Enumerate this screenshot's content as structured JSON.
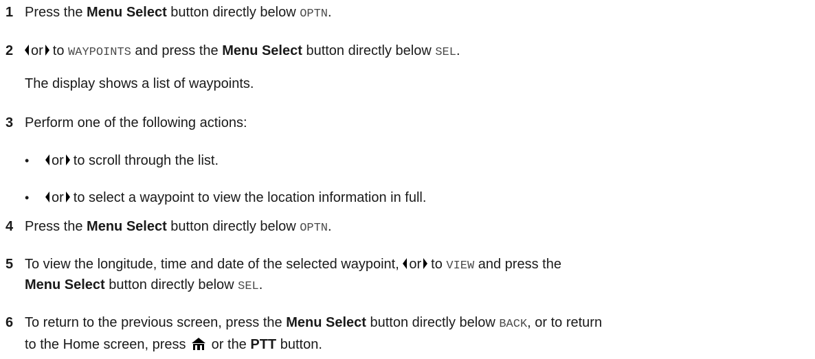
{
  "steps": [
    {
      "num": "1",
      "t1": "Press the ",
      "b1": "Menu Select",
      "t2": " button directly below ",
      "code": "OPTN",
      "end": "."
    },
    {
      "num": "2",
      "t1": "or",
      "t2": "to ",
      "code1": "WAYPOINTS",
      "t3": " and press the ",
      "b1": "Menu Select",
      "t4": " button directly below ",
      "code2": "SEL",
      "end": "."
    },
    {
      "note": "The display shows a list of waypoints."
    },
    {
      "num": "3",
      "t1": "Perform one of the following actions:"
    },
    {
      "bullet": "•",
      "t1": "or",
      "t2": "to scroll through the list."
    },
    {
      "bullet": "•",
      "t1": "or",
      "t2": "to select a waypoint to view the location information in full."
    },
    {
      "num": "4",
      "t1": "Press the ",
      "b1": "Menu Select",
      "t2": " button directly below ",
      "code": "OPTN",
      "end": "."
    },
    {
      "num": "5",
      "t1": "To view the longitude, time and date of the selected waypoint, ",
      "t2": "or",
      "t3": "to ",
      "code1": "VIEW",
      "t4": " and press the",
      "b2": "Menu Select",
      "t5": " button directly below ",
      "code2": "SEL",
      "end": "."
    },
    {
      "num": "6",
      "t1": "To return to the previous screen, press the ",
      "b1": "Menu Select",
      "t2": " button directly below ",
      "code": "BACK",
      "t3": ", or to return",
      "t4": "to the Home screen, press ",
      "t5": " or the ",
      "b2": "PTT",
      "t6": " button."
    }
  ],
  "icons": {
    "arrow_left": "left-arrow-icon",
    "arrow_right": "right-arrow-icon",
    "home": "home-icon"
  },
  "colors": {
    "text": "#1a1a1a",
    "code": "#4a4a4a"
  }
}
